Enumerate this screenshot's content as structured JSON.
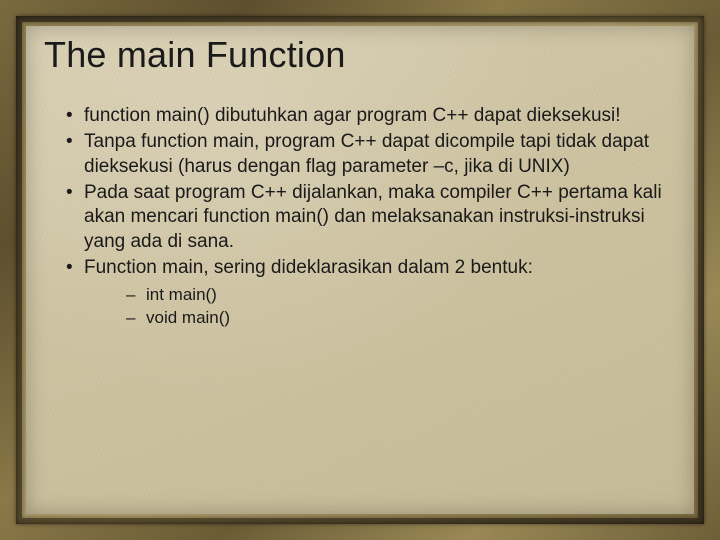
{
  "title": "The main Function",
  "bullets": [
    "function main() dibutuhkan agar program C++ dapat dieksekusi!",
    "Tanpa function main, program C++ dapat dicompile tapi tidak dapat dieksekusi (harus dengan flag parameter –c, jika di UNIX)",
    "Pada saat program C++ dijalankan, maka compiler C++ pertama kali akan mencari function main() dan melaksanakan instruksi-instruksi yang ada di sana.",
    "Function main, sering dideklarasikan dalam 2 bentuk:"
  ],
  "subbullets": [
    "int main()",
    "void main()"
  ]
}
